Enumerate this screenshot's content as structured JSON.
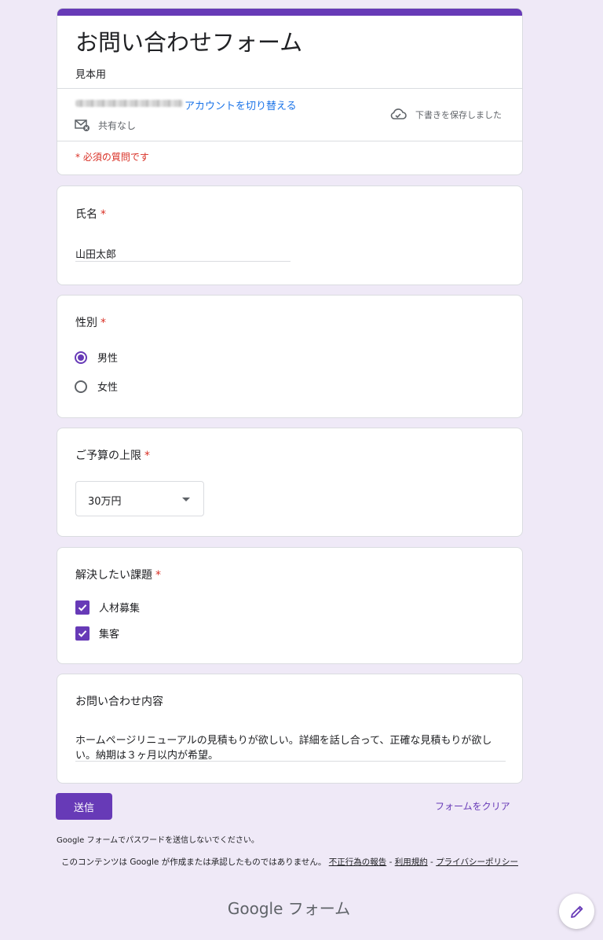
{
  "header": {
    "title": "お問い合わせフォーム",
    "description": "見本用",
    "switch_account": "アカウントを切り替える",
    "share_status": "共有なし",
    "save_status": "下書きを保存しました",
    "required_note": "* 必須の質問です"
  },
  "questions": {
    "name": {
      "title": "氏名",
      "required": "*",
      "answer": "山田太郎"
    },
    "gender": {
      "title": "性別",
      "required": "*",
      "options": [
        {
          "label": "男性",
          "selected": true
        },
        {
          "label": "女性",
          "selected": false
        }
      ]
    },
    "budget": {
      "title": "ご予算の上限",
      "required": "*",
      "selected": "30万円"
    },
    "issues": {
      "title": "解決したい課題",
      "required": "*",
      "options": [
        {
          "label": "人材募集",
          "checked": true
        },
        {
          "label": "集客",
          "checked": true
        }
      ]
    },
    "inquiry": {
      "title": "お問い合わせ内容",
      "answer": "ホームページリニューアルの見積もりが欲しい。詳細を話し合って、正確な見積もりが欲しい。納期は３ヶ月以内が希望。"
    }
  },
  "actions": {
    "submit": "送信",
    "clear": "フォームをクリア"
  },
  "footer": {
    "password_note": "Google フォームでパスワードを送信しないでください。",
    "disclaimer": "このコンテンツは Google が作成または承認したものではありません。",
    "report_abuse": "不正行為の報告",
    "sep1": " - ",
    "terms": "利用規約",
    "sep2": " - ",
    "privacy": "プライバシーポリシー",
    "logo": "Google フォーム"
  },
  "colors": {
    "accent": "#673ab7",
    "background": "#efe9f7",
    "required": "#d93025",
    "link": "#1a73e8"
  }
}
